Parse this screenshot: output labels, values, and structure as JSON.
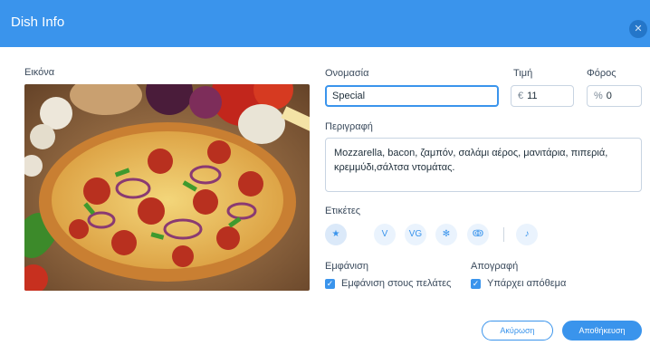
{
  "dialog": {
    "title": "Dish Info",
    "close_icon": "close-icon"
  },
  "image": {
    "label": "Εικόνα"
  },
  "name": {
    "label": "Ονομασία",
    "value": "Special"
  },
  "price": {
    "label": "Τιμή",
    "prefix": "€",
    "value": "11"
  },
  "tax": {
    "label": "Φόρος",
    "prefix": "%",
    "value": "0"
  },
  "description": {
    "label": "Περιγραφή",
    "value": "Mozzarella, bacon, ζαμπόν, σαλάμι αέρος, μανιτάρια, πιπεριά, κρεμμύδι,σάλτσα ντομάτας."
  },
  "tags": {
    "label": "Ετικέτες",
    "items": [
      {
        "icon": "star-icon",
        "glyph": "★"
      },
      {
        "icon": "vegetarian-icon",
        "glyph": "V"
      },
      {
        "icon": "vegan-icon",
        "glyph": "VG"
      },
      {
        "icon": "gluten-free-icon",
        "glyph": "✻"
      },
      {
        "icon": "organic-icon",
        "glyph": "ↂ"
      },
      {
        "icon": "spicy-icon",
        "glyph": "♪"
      }
    ]
  },
  "visibility": {
    "label": "Εμφάνιση",
    "checkbox_label": "Εμφάνιση στους πελάτες",
    "checked": true
  },
  "inventory": {
    "label": "Απογραφή",
    "checkbox_label": "Υπάρχει απόθεμα",
    "checked": true
  },
  "buttons": {
    "cancel": "Ακύρωση",
    "save": "Αποθήκευση"
  },
  "colors": {
    "accent": "#3a94ec",
    "header": "#3a94ec"
  }
}
